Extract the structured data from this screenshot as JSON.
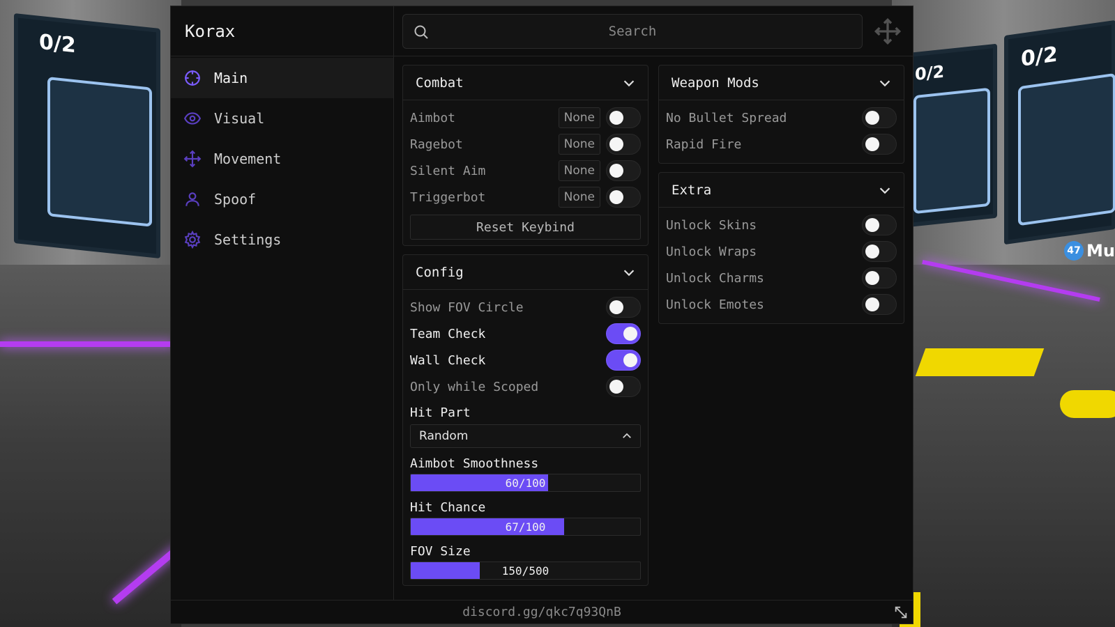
{
  "app": {
    "title": "Korax",
    "footer_link": "discord.gg/qkc7q93QnB"
  },
  "colors": {
    "accent": "#6b4cf5",
    "bg": "#0e0e0e",
    "panel": "#111111"
  },
  "search": {
    "placeholder": "Search",
    "value": ""
  },
  "sidebar": {
    "items": [
      {
        "label": "Main",
        "icon": "crosshair-icon",
        "active": true
      },
      {
        "label": "Visual",
        "icon": "eye-icon",
        "active": false
      },
      {
        "label": "Movement",
        "icon": "move-arrows-icon",
        "active": false
      },
      {
        "label": "Spoof",
        "icon": "user-icon",
        "active": false
      },
      {
        "label": "Settings",
        "icon": "gear-icon",
        "active": false
      }
    ]
  },
  "combat": {
    "title": "Combat",
    "rows": [
      {
        "label": "Aimbot",
        "keybind": "None",
        "on": false
      },
      {
        "label": "Ragebot",
        "keybind": "None",
        "on": false
      },
      {
        "label": "Silent Aim",
        "keybind": "None",
        "on": false
      },
      {
        "label": "Triggerbot",
        "keybind": "None",
        "on": false
      }
    ],
    "reset_label": "Reset Keybind"
  },
  "config": {
    "title": "Config",
    "toggles": [
      {
        "label": "Show FOV Circle",
        "on": false
      },
      {
        "label": "Team Check",
        "on": true
      },
      {
        "label": "Wall Check",
        "on": true
      },
      {
        "label": "Only while Scoped",
        "on": false
      }
    ],
    "hit_part_label": "Hit Part",
    "hit_part_value": "Random",
    "sliders": [
      {
        "label": "Aimbot Smoothness",
        "value": 60,
        "max": 100,
        "text": "60/100"
      },
      {
        "label": "Hit Chance",
        "value": 67,
        "max": 100,
        "text": "67/100"
      },
      {
        "label": "FOV Size",
        "value": 150,
        "max": 500,
        "text": "150/500"
      }
    ]
  },
  "weapon_mods": {
    "title": "Weapon Mods",
    "toggles": [
      {
        "label": "No Bullet Spread",
        "on": false
      },
      {
        "label": "Rapid Fire",
        "on": false
      }
    ]
  },
  "extra": {
    "title": "Extra",
    "toggles": [
      {
        "label": "Unlock Skins",
        "on": false
      },
      {
        "label": "Unlock Wraps",
        "on": false
      },
      {
        "label": "Unlock Charms",
        "on": false
      },
      {
        "label": "Unlock Emotes",
        "on": false
      }
    ]
  },
  "background": {
    "screen_count": "0/2",
    "player_level": "47",
    "player_name": "Mu"
  }
}
